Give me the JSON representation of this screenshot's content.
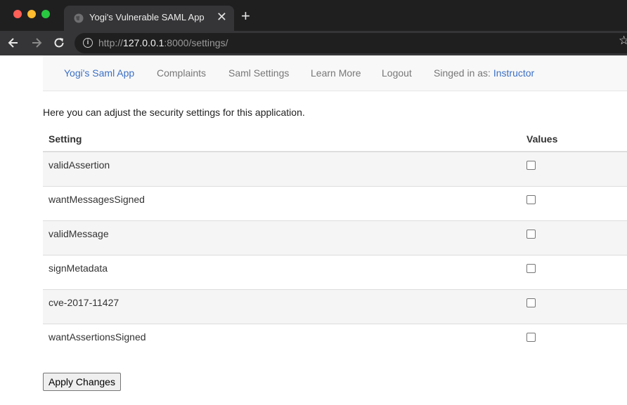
{
  "browser": {
    "tab_title": "Yogi's Vulnerable SAML App",
    "tab_close": "✕",
    "new_tab": "+",
    "url_scheme": "http://",
    "url_host": "127.0.0.1",
    "url_rest": ":8000/settings/",
    "icons": [
      "globe-icon",
      "close-icon",
      "plus-icon",
      "back-arrow-icon",
      "forward-arrow-icon",
      "reload-icon",
      "info-icon",
      "star-icon"
    ]
  },
  "navbar": {
    "brand": "Yogi's Saml App",
    "complaints": "Complaints",
    "saml_settings": "Saml Settings",
    "learn_more": "Learn More",
    "logout": "Logout",
    "signed_in_prefix": "Singed in as: ",
    "signed_in_user": "Instructor"
  },
  "main": {
    "intro": "Here you can adjust the security settings for this application.",
    "table": {
      "headers": {
        "setting": "Setting",
        "values": "Values"
      },
      "rows": [
        {
          "name": "validAssertion",
          "checked": false
        },
        {
          "name": "wantMessagesSigned",
          "checked": false
        },
        {
          "name": "validMessage",
          "checked": false
        },
        {
          "name": "signMetadata",
          "checked": false
        },
        {
          "name": "cve-2017-11427",
          "checked": false
        },
        {
          "name": "wantAssertionsSigned",
          "checked": false
        }
      ]
    },
    "apply_label": "Apply Changes"
  },
  "colors": {
    "link": "#3b6fc4",
    "chrome_dark": "#1f1f20",
    "chrome_mid": "#353537"
  }
}
